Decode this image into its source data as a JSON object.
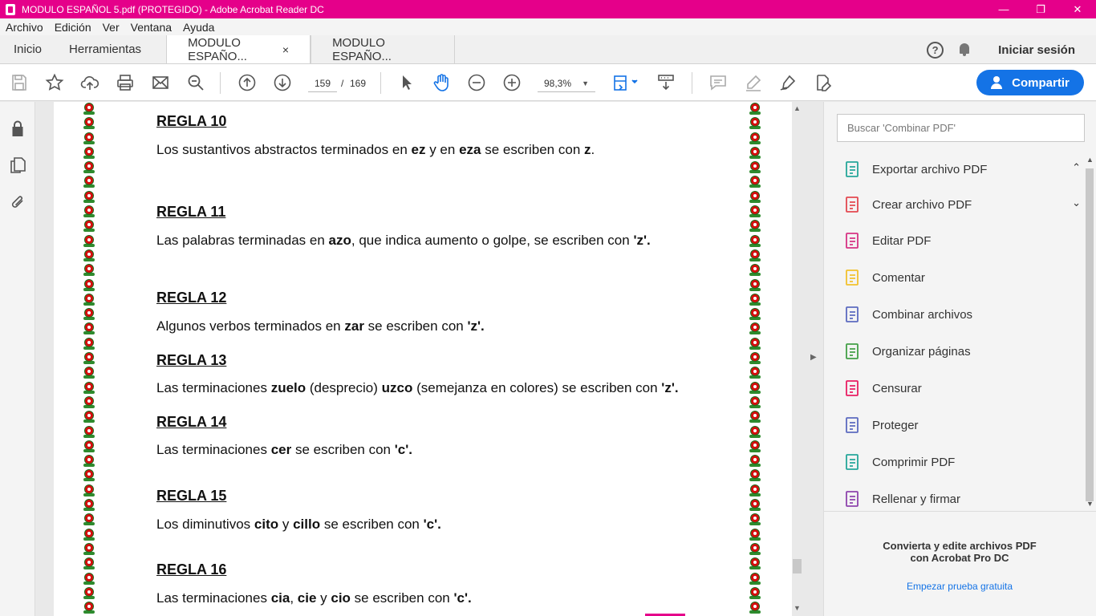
{
  "window": {
    "title": "MODULO ESPAÑOL 5.pdf (PROTEGIDO) - Adobe Acrobat Reader DC",
    "minimize": "—",
    "restore": "❐",
    "close": "✕"
  },
  "menu": [
    "Archivo",
    "Edición",
    "Ver",
    "Ventana",
    "Ayuda"
  ],
  "tabs": {
    "home": "Inicio",
    "tools": "Herramientas",
    "doc1": "MODULO ESPAÑO...",
    "doc2": "MODULO ESPAÑO...",
    "close": "×"
  },
  "header_right": {
    "help": "?",
    "signin": "Iniciar sesión"
  },
  "toolbar": {
    "page_current": "159",
    "page_sep": "/",
    "page_total": "169",
    "zoom": "98,3%",
    "share": "Compartir"
  },
  "document": {
    "reglas": [
      {
        "title": "REGLA 10",
        "parts": [
          [
            "Los sustantivos abstractos terminados en ",
            false
          ],
          [
            "ez",
            true
          ],
          [
            " y en ",
            false
          ],
          [
            "eza",
            true
          ],
          [
            " se escriben con ",
            false
          ],
          [
            "z",
            true
          ],
          [
            ".",
            false
          ]
        ]
      },
      {
        "title": "REGLA 11",
        "parts": [
          [
            "Las palabras terminadas en ",
            false
          ],
          [
            "azo",
            true
          ],
          [
            ", que indica aumento o golpe, se escriben con ",
            false
          ],
          [
            "'z'.",
            true
          ]
        ]
      },
      {
        "title": "REGLA 12",
        "parts": [
          [
            "Algunos verbos terminados en ",
            false
          ],
          [
            "zar",
            true
          ],
          [
            " se escriben con ",
            false
          ],
          [
            "'z'.",
            true
          ]
        ]
      },
      {
        "title": "REGLA 13",
        "parts": [
          [
            "Las terminaciones ",
            false
          ],
          [
            "zuelo",
            true
          ],
          [
            " (desprecio) ",
            false
          ],
          [
            "uzco",
            true
          ],
          [
            " (semejanza en colores) se escriben con ",
            false
          ],
          [
            "'z'.",
            true
          ]
        ]
      },
      {
        "title": "REGLA 14",
        "parts": [
          [
            "Las terminaciones ",
            false
          ],
          [
            "cer",
            true
          ],
          [
            " se escriben con ",
            false
          ],
          [
            "'c'.",
            true
          ]
        ]
      },
      {
        "title": "REGLA 15",
        "parts": [
          [
            "Los diminutivos ",
            false
          ],
          [
            "cito",
            true
          ],
          [
            " y ",
            false
          ],
          [
            "cillo",
            true
          ],
          [
            " se escriben con ",
            false
          ],
          [
            "'c'.",
            true
          ]
        ]
      },
      {
        "title": "REGLA 16",
        "parts": [
          [
            "Las terminaciones ",
            false
          ],
          [
            "cia",
            true
          ],
          [
            ", ",
            false
          ],
          [
            "cie",
            true
          ],
          [
            " y ",
            false
          ],
          [
            "cio",
            true
          ],
          [
            " se escriben con ",
            false
          ],
          [
            "'c'.",
            true
          ]
        ]
      }
    ]
  },
  "right_panel": {
    "search_placeholder": "Buscar 'Combinar PDF'",
    "tools": [
      {
        "label": "Exportar archivo PDF",
        "icon": "export-pdf-icon",
        "color": "#26a69a",
        "chevron": "⌃"
      },
      {
        "label": "Crear archivo PDF",
        "icon": "create-pdf-icon",
        "color": "#e34850",
        "chevron": "⌄"
      },
      {
        "label": "Editar PDF",
        "icon": "edit-pdf-icon",
        "color": "#d63384",
        "chevron": ""
      },
      {
        "label": "Comentar",
        "icon": "comment-icon",
        "color": "#f2c12e",
        "chevron": ""
      },
      {
        "label": "Combinar archivos",
        "icon": "combine-files-icon",
        "color": "#5c6bc0",
        "chevron": ""
      },
      {
        "label": "Organizar páginas",
        "icon": "organize-pages-icon",
        "color": "#43a047",
        "chevron": ""
      },
      {
        "label": "Censurar",
        "icon": "redact-icon",
        "color": "#e91e63",
        "chevron": ""
      },
      {
        "label": "Proteger",
        "icon": "protect-icon",
        "color": "#5c6bc0",
        "chevron": ""
      },
      {
        "label": "Comprimir PDF",
        "icon": "compress-pdf-icon",
        "color": "#26a69a",
        "chevron": ""
      },
      {
        "label": "Rellenar y firmar",
        "icon": "fill-sign-icon",
        "color": "#8e44ad",
        "chevron": ""
      }
    ],
    "promo_line1": "Convierta y edite archivos PDF",
    "promo_line2": "con Acrobat Pro DC",
    "promo_link": "Empezar prueba gratuita"
  }
}
